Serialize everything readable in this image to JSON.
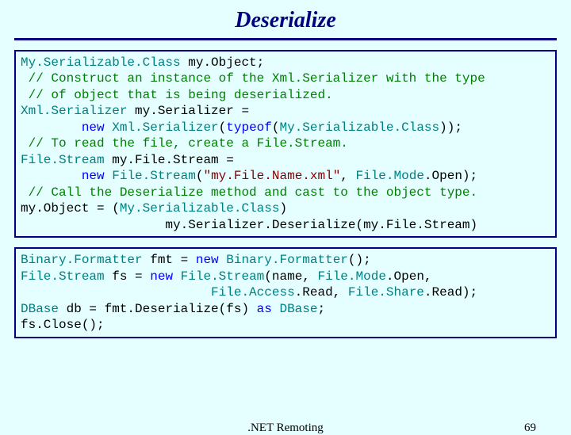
{
  "title": "Deserialize",
  "code1": {
    "l1a": "My.Serializable.Class",
    "l1b": " my.Object;",
    "l2": " // Construct an instance of the Xml.Serializer with the type",
    "l3": " // of object that is being deserialized.",
    "l4a": "Xml.Serializer",
    "l4b": " my.Serializer = ",
    "l5a": "        ",
    "l5b": "new",
    "l5c": " ",
    "l5d": "Xml.Serializer",
    "l5e": "(",
    "l5f": "typeof",
    "l5g": "(",
    "l5h": "My.Serializable.Class",
    "l5i": "));",
    "l6": " // To read the file, create a File.Stream.",
    "l7a": "File.Stream",
    "l7b": " my.File.Stream = ",
    "l8a": "        ",
    "l8b": "new",
    "l8c": " ",
    "l8d": "File.Stream",
    "l8e": "(",
    "l8f": "\"my.File.Name.xml\"",
    "l8g": ", ",
    "l8h": "File.Mode",
    "l8i": ".Open);",
    "l9": " // Call the Deserialize method and cast to the object type.",
    "l10a": "my.Object = (",
    "l10b": "My.Serializable.Class",
    "l10c": ") ",
    "l11": "                   my.Serializer.Deserialize(my.File.Stream)"
  },
  "code2": {
    "l1a": "Binary.Formatter",
    "l1b": " fmt = ",
    "l1c": "new",
    "l1d": " ",
    "l1e": "Binary.Formatter",
    "l1f": "();",
    "l2a": "File.Stream",
    "l2b": " fs = ",
    "l2c": "new",
    "l2d": " ",
    "l2e": "File.Stream",
    "l2f": "(name, ",
    "l2g": "File.Mode",
    "l2h": ".Open, ",
    "l3a": "                         ",
    "l3b": "File.Access",
    "l3c": ".Read, ",
    "l3d": "File.Share",
    "l3e": ".Read);",
    "l4a": "DBase",
    "l4b": " db = fmt.Deserialize(fs) ",
    "l4c": "as",
    "l4d": " ",
    "l4e": "DBase",
    "l4f": ";",
    "l5": "fs.Close();"
  },
  "footer": {
    "center": ".NET Remoting",
    "page": "69"
  }
}
